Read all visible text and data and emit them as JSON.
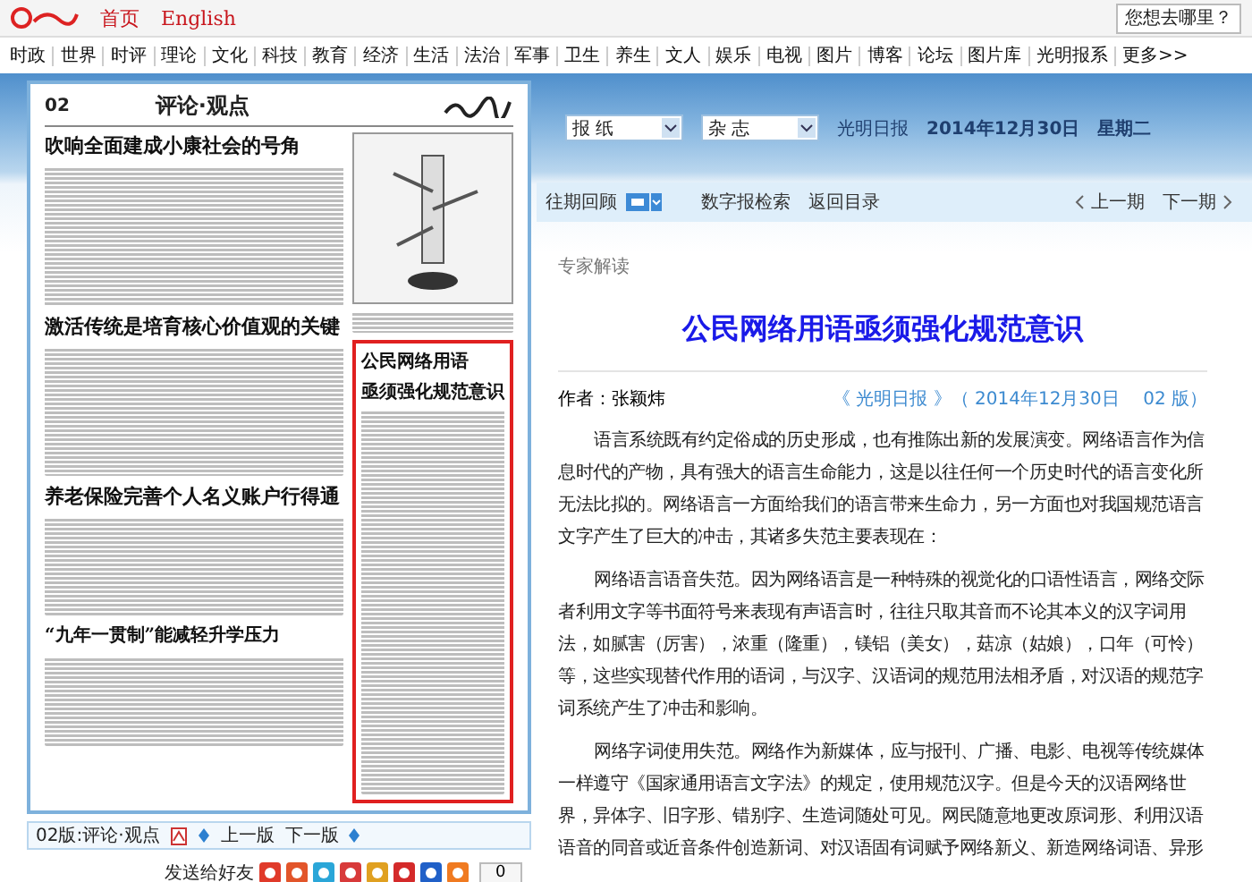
{
  "top_bar": {
    "links": [
      "首页",
      "English"
    ],
    "search_button": "您想去哪里？"
  },
  "nav": [
    "时政",
    "世界",
    "时评",
    "理论",
    "文化",
    "科技",
    "教育",
    "经济",
    "生活",
    "法治",
    "军事",
    "卫生",
    "养生",
    "文人",
    "娱乐",
    "电视",
    "图片",
    "博客",
    "论坛",
    "图片库",
    "光明报系",
    "更多>>"
  ],
  "newspaper": {
    "page_number": "02",
    "section": "评论·观点",
    "headlines": [
      "吹响全面建成小康社会的号角",
      "激活传统是培育核心价值观的关键",
      "养老保险完善个人名义账户行得通"
    ],
    "sub_headline": "“九年一贯制”能减轻升学压力",
    "highlight_title": [
      "公民网络用语",
      "亟须强化规范意识"
    ]
  },
  "page_footer": {
    "label": "02版:评论·观点",
    "prev": "上一版",
    "next": "下一版"
  },
  "share": {
    "label": "发送给好友",
    "count": "0"
  },
  "selectors": [
    "报 纸",
    "杂 志"
  ],
  "issue_info": {
    "paper": "光明日报",
    "date": "2014年12月30日",
    "weekday": "星期二"
  },
  "toolbar": {
    "items": [
      "往期回顾",
      "数字报检索",
      "返回目录"
    ],
    "prev": "上一期",
    "next": "下一期"
  },
  "article": {
    "column": "专家解读",
    "title": "公民网络用语亟须强化规范意识",
    "author": "作者：张颖炜",
    "source": "《 光明日报 》（ 2014年12月30日　 02 版）",
    "paragraphs": [
      "语言系统既有约定俗成的历史形成，也有推陈出新的发展演变。网络语言作为信息时代的产物，具有强大的语言生命能力，这是以往任何一个历史时代的语言变化所无法比拟的。网络语言一方面给我们的语言带来生命力，另一方面也对我国规范语言文字产生了巨大的冲击，其诸多失范主要表现在：",
      "网络语言语音失范。因为网络语言是一种特殊的视觉化的口语性语言，网络交际者利用文字等书面符号来表现有声语言时，往往只取其音而不论其本义的汉字词用法，如腻害（厉害），浓重（隆重），镁铝（美女），菇凉（姑娘），口年（可怜）等，这些实现替代作用的语词，与汉字、汉语词的规范用法相矛盾，对汉语的规范字词系统产生了冲击和影响。",
      "网络字词使用失范。网络作为新媒体，应与报刊、广播、电影、电视等传统媒体一样遵守《国家通用语言文字法》的规定，使用规范汉字。但是今天的汉语网络世界，异体字、旧字形、错别字、生造词随处可见。网民随意地更改原词形、利用汉语语音的同音或近音条件创造新词、对汉语固有词赋予网络新义、新造网络词语、异形"
    ]
  }
}
